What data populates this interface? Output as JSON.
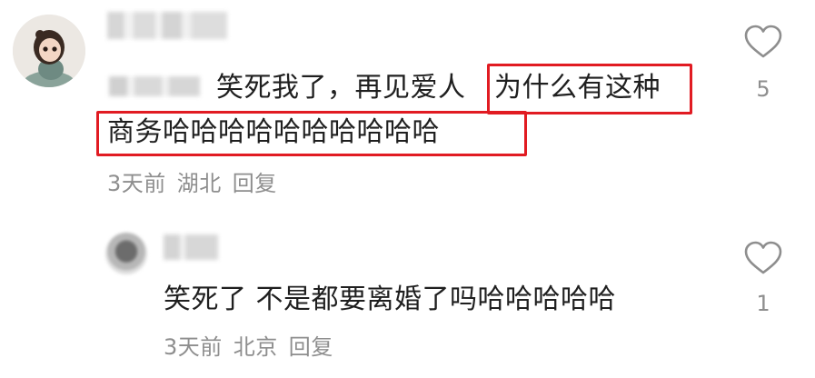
{
  "comment": {
    "text_before_highlight": "笑死我了，再见爱人",
    "text_highlight_1": "为什么有这种",
    "text_highlight_2": "商务哈哈哈哈哈哈哈哈哈哈",
    "time": "3天前",
    "location": "湖北",
    "reply_label": "回复",
    "like_count": "5"
  },
  "reply": {
    "text": "笑死了 不是都要离婚了吗哈哈哈哈哈",
    "time": "3天前",
    "location": "北京",
    "reply_label": "回复",
    "like_count": "1"
  },
  "colors": {
    "highlight_border": "#e11b22",
    "text": "#1f1f1f",
    "meta": "#8e8e8e"
  },
  "icons": [
    "heart-outline-icon"
  ]
}
